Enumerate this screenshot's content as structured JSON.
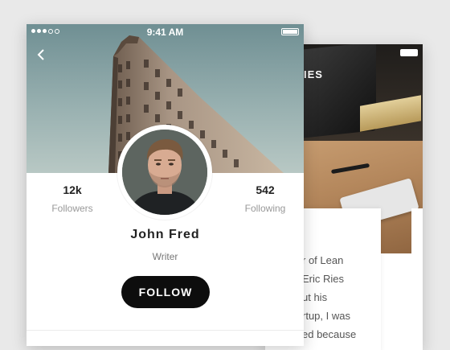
{
  "status_bar": {
    "time": "9:41 AM"
  },
  "profile": {
    "followers_count": "12k",
    "followers_label": "Followers",
    "following_count": "542",
    "following_label": "Following",
    "name": "John Fred",
    "role": "Writer",
    "follow_label": "FOLLOW"
  },
  "back_screen": {
    "title_fragment": "IES",
    "text_lines": [
      "r of Lean",
      "Eric Ries",
      "ut his",
      "rtup, I was",
      "ed because"
    ]
  },
  "icons": {
    "back": "chevron-left-icon",
    "signal": "signal-dots-icon",
    "battery": "battery-icon"
  },
  "colors": {
    "follow_button": "#0d0d0d",
    "background": "#e9e9e9"
  }
}
